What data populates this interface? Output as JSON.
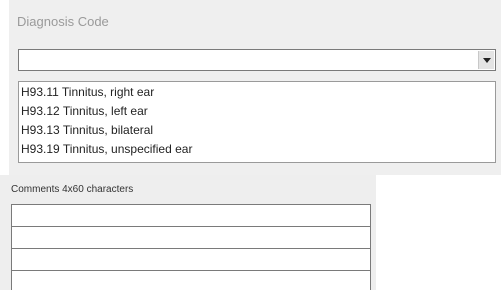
{
  "diagnosis": {
    "label": "Diagnosis Code",
    "selected_value": "",
    "options": [
      "H93.11 Tinnitus, right ear",
      "H93.12 Tinnitus, left ear",
      "H93.13 Tinnitus, bilateral",
      "H93.19 Tinnitus, unspecified ear"
    ]
  },
  "comments": {
    "label": "Comments 4x60 characters",
    "lines": [
      "",
      "",
      "",
      ""
    ]
  },
  "icons": {
    "dropdown": "chevron-down-icon"
  }
}
